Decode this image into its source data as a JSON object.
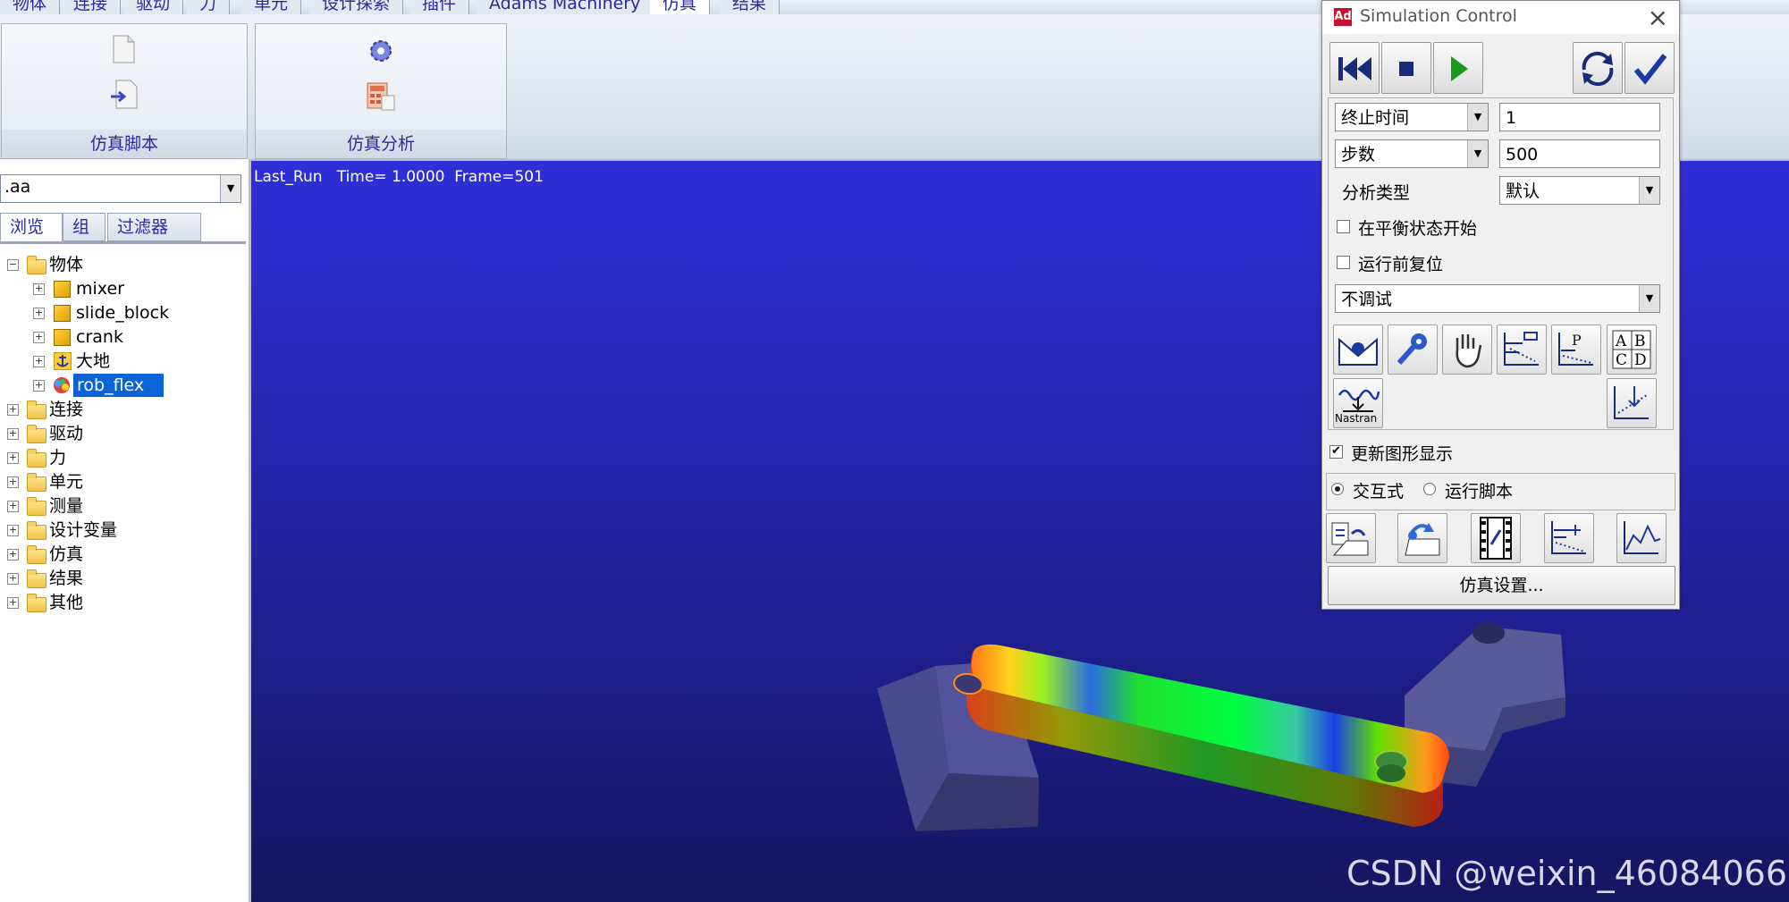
{
  "menu_tabs": [
    {
      "label": "物体"
    },
    {
      "label": "连接"
    },
    {
      "label": "驱动"
    },
    {
      "label": "力"
    },
    {
      "label": "单元"
    },
    {
      "label": "设计探索"
    },
    {
      "label": "插件"
    },
    {
      "label": "Adams Machinery"
    },
    {
      "label": "仿真",
      "active": true
    },
    {
      "label": "结果"
    }
  ],
  "ribbon": {
    "groups": [
      {
        "caption": "仿真脚本",
        "icons": [
          "new-script-icon",
          "import-script-icon"
        ]
      },
      {
        "caption": "仿真分析",
        "icons": [
          "simulation-gear-icon",
          "calculator-icon"
        ]
      }
    ]
  },
  "left_panel": {
    "model_name": ".aa",
    "tabs": [
      {
        "label": "浏览",
        "active": true
      },
      {
        "label": "组"
      },
      {
        "label": "过滤器"
      }
    ],
    "tree": [
      {
        "label": "物体",
        "expanded": true,
        "children": [
          {
            "label": "mixer",
            "icon": "part-icon"
          },
          {
            "label": "slide_block",
            "icon": "part-icon"
          },
          {
            "label": "crank",
            "icon": "part-icon"
          },
          {
            "label": "大地",
            "icon": "ground-icon"
          },
          {
            "label": "rob_flex",
            "icon": "flex-body-icon",
            "selected": true
          }
        ]
      },
      {
        "label": "连接"
      },
      {
        "label": "驱动"
      },
      {
        "label": "力"
      },
      {
        "label": "单元"
      },
      {
        "label": "测量"
      },
      {
        "label": "设计变量"
      },
      {
        "label": "仿真"
      },
      {
        "label": "结果"
      },
      {
        "label": "其他"
      }
    ]
  },
  "viewport": {
    "run_info": "Last_Run   Time= 1.0000  Frame=501",
    "background_top": "#2f2fd8",
    "background_bottom": "#151560"
  },
  "sim_control": {
    "title": "Simulation Control",
    "playback_buttons": [
      "rewind-icon",
      "stop-icon",
      "play-icon"
    ],
    "action_buttons": [
      "reset-cycle-icon",
      "accept-check-icon"
    ],
    "end_mode": {
      "value": "终止时间"
    },
    "end_value": "1",
    "step_mode": {
      "value": "步数"
    },
    "step_value": "500",
    "analysis_type_label": "分析类型",
    "analysis_type_value": "默认",
    "start_at_equilibrium": {
      "label": "在平衡状态开始",
      "checked": false
    },
    "reset_before_run": {
      "label": "运行前复位",
      "checked": false
    },
    "debug_mode": "不调试",
    "tool_icons": [
      "static-equilibrium-icon",
      "key-icon",
      "hand-icon",
      "scripted-table-icon",
      "plot-p-icon",
      "abcd-table-icon",
      "nastran-icon",
      "measure-plot-icon"
    ],
    "nastran_label": "Nastran",
    "update_graphics": {
      "label": "更新图形显示",
      "checked": true
    },
    "mode_interactive": {
      "label": "交互式",
      "checked": true
    },
    "mode_script": {
      "label": "运行脚本",
      "checked": false
    },
    "bottom_icons": [
      "open-results-icon",
      "save-results-icon",
      "animation-film-icon",
      "measure-list-icon",
      "plot-icon"
    ],
    "setup_button": "仿真设置..."
  },
  "watermark": "CSDN @weixin_46084066",
  "colors": {
    "accent": "#2a2aa0",
    "selection": "#0a64d8",
    "viewport_mid": "#2626b4"
  }
}
